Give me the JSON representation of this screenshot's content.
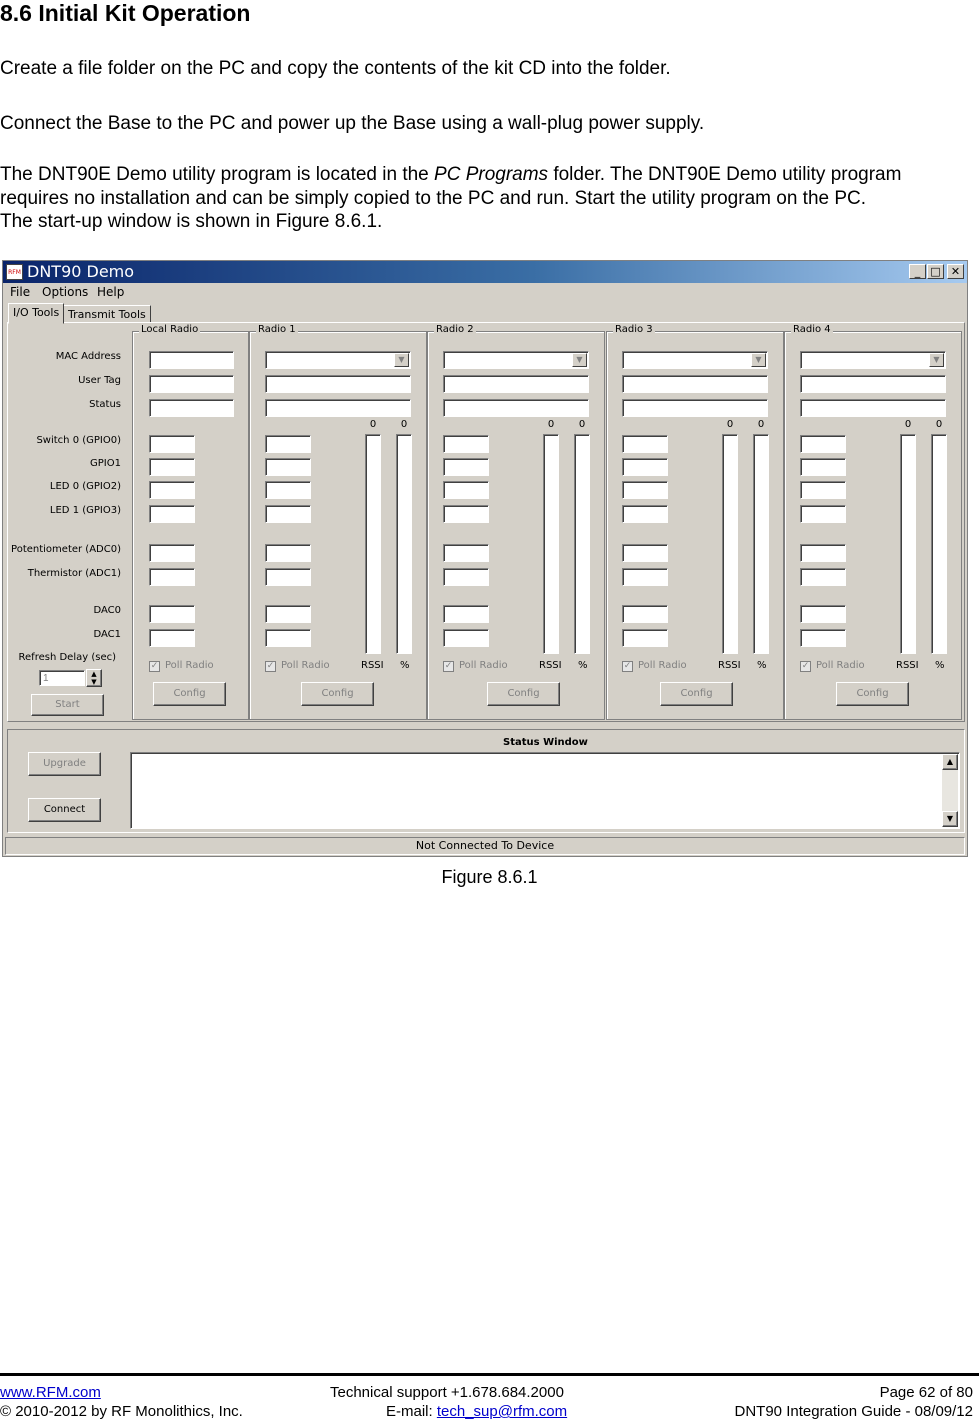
{
  "heading": "8.6 Initial Kit Operation",
  "paragraphs": {
    "p1": "Create a file folder on the PC and copy the contents of the kit CD into the folder.",
    "p2": "Connect the Base to the PC and power up the Base using a wall-plug power supply.",
    "p3a": "The DNT90E Demo utility program is located in the ",
    "p3_em": "PC Programs",
    "p3b": " folder. The DNT90E Demo utility program",
    "p3c": "requires no installation and can be simply copied to the PC and run. Start the utility program on the PC.",
    "p3d": "The start-up window is shown in Figure 8.6.1."
  },
  "window": {
    "title": "DNT90 Demo",
    "icon_text": "RFM",
    "controls": [
      "_",
      "□",
      "✕"
    ],
    "menu": [
      "File",
      "Options",
      "Help"
    ],
    "tabs": [
      "I/O Tools",
      "Transmit Tools"
    ],
    "labels": [
      "MAC Address",
      "User Tag",
      "Status",
      "Switch 0 (GPIO0)",
      "GPIO1",
      "LED 0 (GPIO2)",
      "LED 1 (GPIO3)",
      "Potentiometer (ADC0)",
      "Thermistor (ADC1)",
      "DAC0",
      "DAC1",
      "Refresh Delay (sec)"
    ],
    "refresh_delay": "1",
    "start_button": "Start",
    "local_group": "Local Radio",
    "radio_groups": [
      "Radio 1",
      "Radio 2",
      "Radio 3",
      "Radio 4"
    ],
    "rssi_value": "0",
    "pct_value": "0",
    "rssi_label": "RSSI",
    "pct_label": "%",
    "poll_label": "Poll Radio",
    "config_label": "Config",
    "status_window_title": "Status Window",
    "upgrade_button": "Upgrade",
    "connect_button": "Connect",
    "status_bar": "Not Connected To Device"
  },
  "caption": "Figure 8.6.1",
  "footer": {
    "website": "www.RFM.com",
    "support": "Technical support +1.678.684.2000",
    "page": "Page 62 of 80",
    "copyright": "© 2010-2012 by RF Monolithics, Inc.",
    "email_label": "E-mail: ",
    "email": "tech_sup@rfm.com",
    "guide": "DNT90 Integration Guide - 08/09/12"
  }
}
